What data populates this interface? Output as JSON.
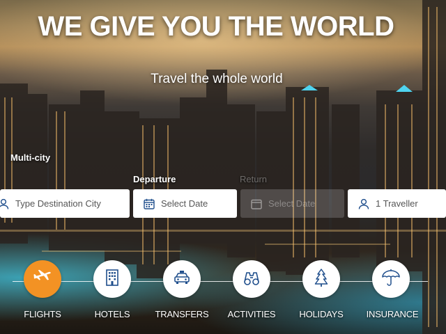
{
  "hero": {
    "title": "WE GIVE YOU THE WORLD",
    "subtitle": "Travel the whole world"
  },
  "search": {
    "mode_label": "Multi-city",
    "departure_label": "Departure",
    "return_label": "Return",
    "destination_placeholder": "Type Destination City",
    "departure_placeholder": "Select Date",
    "return_placeholder": "Select Date",
    "travellers": "1 Traveller"
  },
  "services": [
    {
      "label": "FLIGHTS",
      "icon": "plane-icon",
      "active": true
    },
    {
      "label": "HOTELS",
      "icon": "hotel-icon",
      "active": false
    },
    {
      "label": "TRANSFERS",
      "icon": "taxi-icon",
      "active": false
    },
    {
      "label": "ACTIVITIES",
      "icon": "binoculars-icon",
      "active": false
    },
    {
      "label": "HOLIDAYS",
      "icon": "tree-icon",
      "active": false
    },
    {
      "label": "INSURANCE",
      "icon": "umbrella-icon",
      "active": false
    }
  ],
  "colors": {
    "accent": "#f39224",
    "icon_blue": "#1f4e8c"
  }
}
